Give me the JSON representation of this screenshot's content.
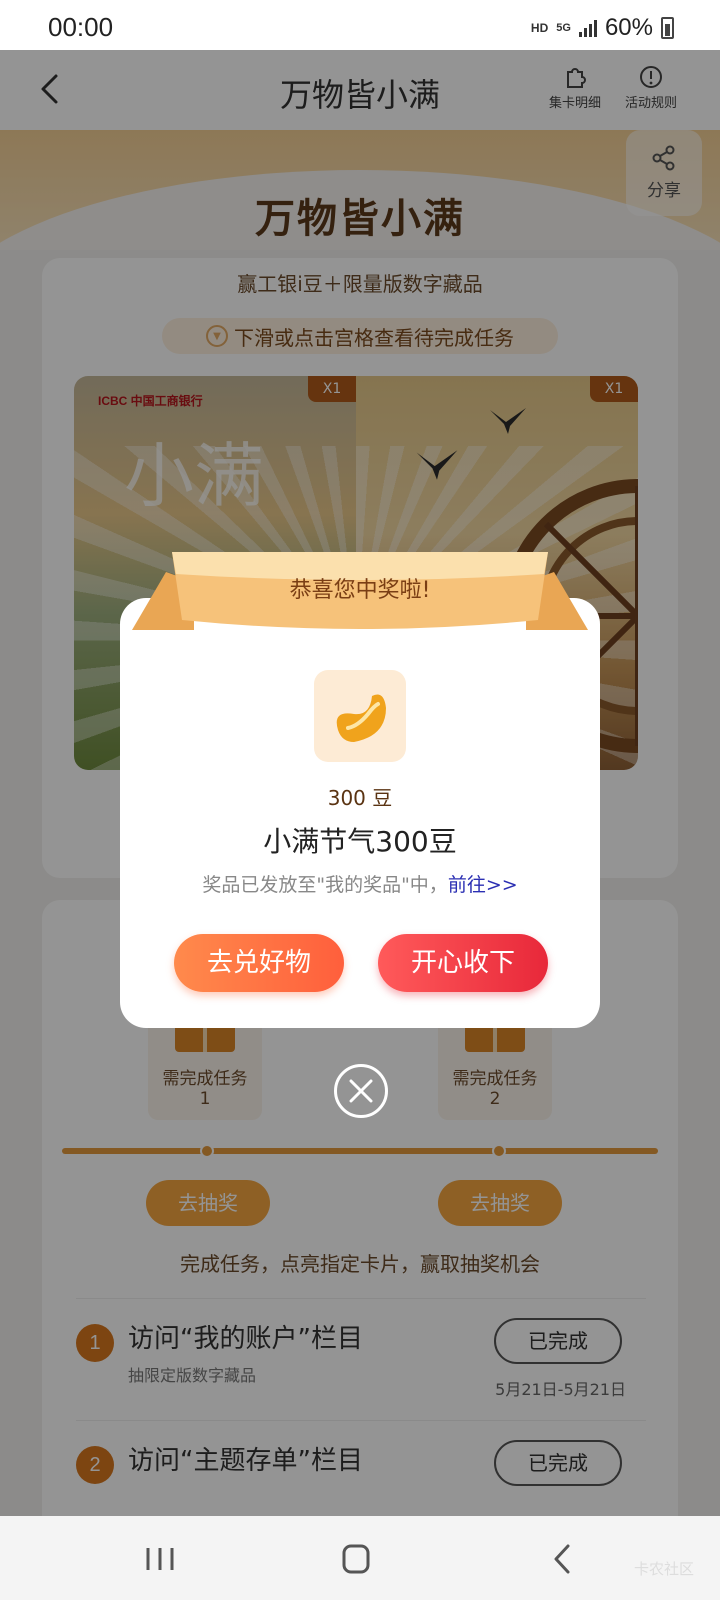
{
  "status_bar": {
    "time": "00:00",
    "hd": "HD",
    "network": "5G",
    "battery": "60%"
  },
  "header": {
    "title": "万物皆小满",
    "card_detail": "集卡明细",
    "rules": "活动规则"
  },
  "hero": {
    "title": "万物皆小满",
    "share": "分享"
  },
  "main": {
    "subtitle": "赢工银i豆＋限量版数字藏品",
    "hint": "下滑或点击宫格查看待完成任务",
    "cards": [
      {
        "badge": "X1",
        "logo": "ICBC 中国工商银行",
        "calligraphy": "小满"
      },
      {
        "badge": "X1"
      }
    ]
  },
  "tasks_section": {
    "gifts": [
      {
        "label": "需完成任务",
        "count": "1"
      },
      {
        "label": "需完成任务",
        "count": "2"
      }
    ],
    "draw_buttons": [
      "去抽奖",
      "去抽奖"
    ],
    "hint": "完成任务，点亮指定卡片，赢取抽奖机会",
    "tasks": [
      {
        "num": "1",
        "title": "访问“我的账户”栏目",
        "sub": "抽限定版数字藏品",
        "status": "已完成",
        "date": "5月21日-5月21日"
      },
      {
        "num": "2",
        "title": "访问“主题存单”栏目",
        "status": "已完成"
      }
    ]
  },
  "dialog": {
    "ribbon": "恭喜您中奖啦!",
    "prize_qty": "300 豆",
    "prize_name": "小满节气300豆",
    "note": "奖品已发放至\"我的奖品\"中，",
    "link": "前往>>",
    "btn_exchange": "去兑好物",
    "btn_accept": "开心收下"
  },
  "watermark": "卡农社区",
  "colors": {
    "accent": "#e49a3d",
    "primary_red": "#e8283a",
    "orange": "#ff6a3d"
  }
}
